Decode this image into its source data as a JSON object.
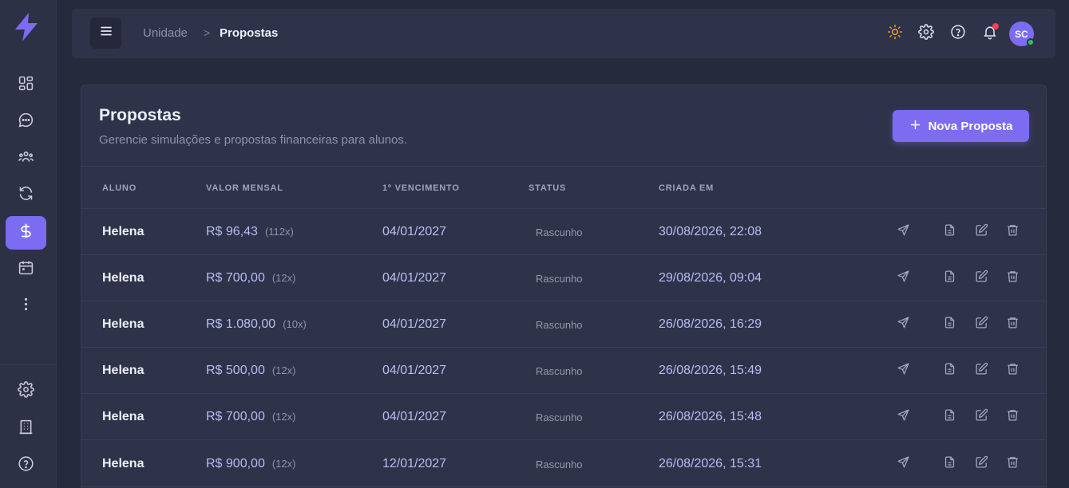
{
  "sidebar": {
    "logo_icon": "lightning-bolt-icon",
    "accent_color": "#7c6cf2",
    "items": [
      {
        "icon": "dashboard-icon"
      },
      {
        "icon": "chat-icon"
      },
      {
        "icon": "users-icon"
      },
      {
        "icon": "sync-icon"
      },
      {
        "icon": "dollar-icon",
        "active": true
      },
      {
        "icon": "calendar-icon"
      },
      {
        "icon": "more-vertical-icon"
      }
    ],
    "bottom_items": [
      {
        "icon": "gear-icon"
      },
      {
        "icon": "building-icon"
      },
      {
        "icon": "help-icon"
      }
    ]
  },
  "header": {
    "breadcrumb": {
      "parent": "Unidade",
      "separator": ">",
      "current": "Propostas"
    },
    "avatar_initials": "SC",
    "notification_dot_color": "#ef4453",
    "online_color": "#2fc45f",
    "theme_icon_color": "#f59e33"
  },
  "page": {
    "title": "Propostas",
    "subtitle": "Gerencie simulações e propostas financeiras para alunos.",
    "new_button": "Nova Proposta"
  },
  "table": {
    "columns": [
      "ALUNO",
      "VALOR MENSAL",
      "1º VENCIMENTO",
      "STATUS",
      "CRIADA EM"
    ],
    "rows": [
      {
        "aluno": "Helena",
        "valor": "R$ 96,43",
        "parcelas": "(112x)",
        "vencimento": "04/01/2027",
        "status": "Rascunho",
        "criada": "30/08/2026, 22:08"
      },
      {
        "aluno": "Helena",
        "valor": "R$ 700,00",
        "parcelas": "(12x)",
        "vencimento": "04/01/2027",
        "status": "Rascunho",
        "criada": "29/08/2026, 09:04"
      },
      {
        "aluno": "Helena",
        "valor": "R$ 1.080,00",
        "parcelas": "(10x)",
        "vencimento": "04/01/2027",
        "status": "Rascunho",
        "criada": "26/08/2026, 16:29"
      },
      {
        "aluno": "Helena",
        "valor": "R$ 500,00",
        "parcelas": "(12x)",
        "vencimento": "04/01/2027",
        "status": "Rascunho",
        "criada": "26/08/2026, 15:49"
      },
      {
        "aluno": "Helena",
        "valor": "R$ 700,00",
        "parcelas": "(12x)",
        "vencimento": "04/01/2027",
        "status": "Rascunho",
        "criada": "26/08/2026, 15:48"
      },
      {
        "aluno": "Helena",
        "valor": "R$ 900,00",
        "parcelas": "(12x)",
        "vencimento": "12/01/2027",
        "status": "Rascunho",
        "criada": "26/08/2026, 15:31"
      }
    ],
    "row_actions": [
      "send-icon",
      "document-icon",
      "edit-icon",
      "trash-icon"
    ]
  }
}
